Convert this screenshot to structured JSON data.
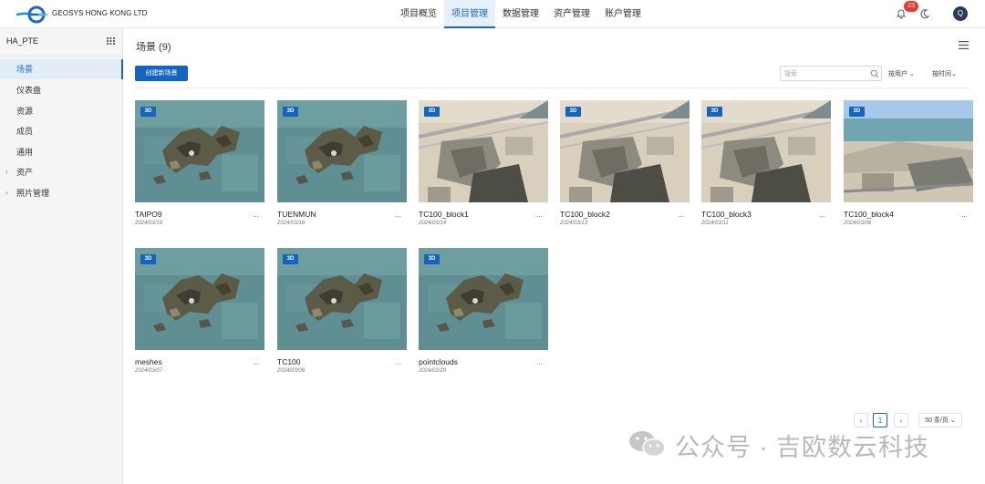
{
  "header": {
    "brand": "GEOSYS HONG KONG LTD",
    "nav": [
      "项目概览",
      "项目管理",
      "数据管理",
      "资产管理",
      "账户管理"
    ],
    "active_nav_index": 1,
    "notification_count": "23",
    "avatar_initial": "Q"
  },
  "sidebar": {
    "project": "HA_PTE",
    "items": [
      {
        "label": "场景",
        "active": true,
        "expandable": false
      },
      {
        "label": "仪表盘",
        "active": false,
        "expandable": false
      },
      {
        "label": "资源",
        "active": false,
        "expandable": false
      },
      {
        "label": "成员",
        "active": false,
        "expandable": false
      },
      {
        "label": "通用",
        "active": false,
        "expandable": false
      },
      {
        "label": "资产",
        "active": false,
        "expandable": true
      },
      {
        "label": "照片管理",
        "active": false,
        "expandable": true
      }
    ]
  },
  "main": {
    "title": "场景 (9)",
    "create_label": "创建新场景",
    "search_placeholder": "搜索",
    "sort_user": "按用户",
    "sort_time": "按时间"
  },
  "cards": [
    {
      "name": "TAIPO9",
      "date": "2024/03/19",
      "badge": "3D",
      "thumb": "map",
      "more": "..."
    },
    {
      "name": "TUENMUN",
      "date": "2024/03/18",
      "badge": "3D",
      "thumb": "map",
      "more": "..."
    },
    {
      "name": "TC100_block1",
      "date": "2024/03/14",
      "badge": "3D",
      "thumb": "aerial",
      "more": "..."
    },
    {
      "name": "TC100_block2",
      "date": "2024/03/13",
      "badge": "3D",
      "thumb": "aerial",
      "more": "..."
    },
    {
      "name": "TC100_block3",
      "date": "2024/03/11",
      "badge": "3D",
      "thumb": "aerial",
      "more": "..."
    },
    {
      "name": "TC100_block4",
      "date": "2024/03/08",
      "badge": "3D",
      "thumb": "horizon",
      "more": "..."
    },
    {
      "name": "meshes",
      "date": "2024/03/07",
      "badge": "3D",
      "thumb": "map",
      "more": "..."
    },
    {
      "name": "TC100",
      "date": "2024/03/06",
      "badge": "3D",
      "thumb": "map",
      "more": "..."
    },
    {
      "name": "pointclouds",
      "date": "2024/02/29",
      "badge": "3D",
      "thumb": "map",
      "more": "..."
    }
  ],
  "pagination": {
    "prev": "‹",
    "current_page": "1",
    "next": "›",
    "page_size": "50 条/页"
  },
  "watermark": "公众号 · 吉欧数云科技",
  "colors": {
    "accent": "#1565c0",
    "badge": "#e53935",
    "sidebar_bg": "#f5f5f5"
  }
}
